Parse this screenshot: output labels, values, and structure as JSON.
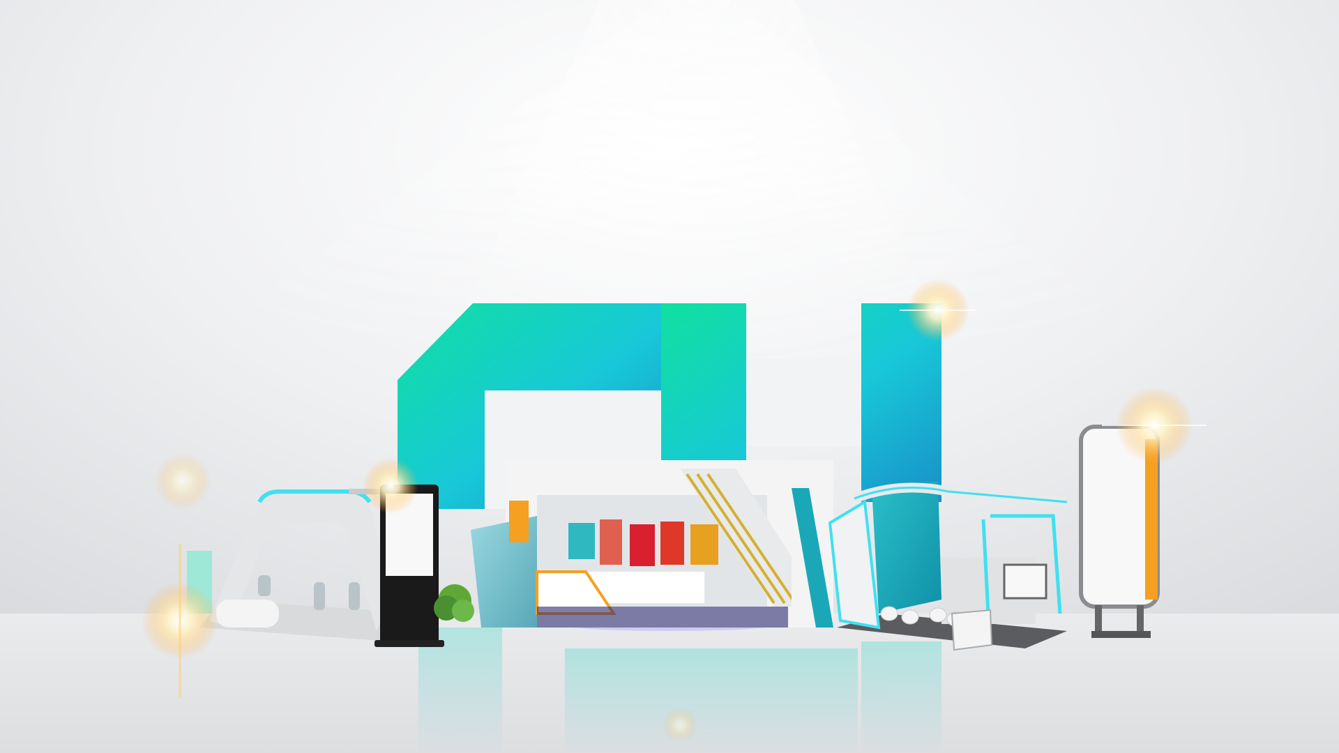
{
  "scene": {
    "subject": "exhibition-stands-render",
    "logo_letters": "CH",
    "colors": {
      "background": "#e8e9eb",
      "logo_green": "#10e0a0",
      "logo_cyan": "#18c8d8",
      "logo_blue": "#1898c8",
      "accent_cyan": "#40e0f0",
      "accent_orange": "#f5a020",
      "kiosk_black": "#1a1a1a",
      "booth_white": "#f4f4f4",
      "booth_teal": "#1aa8b8"
    },
    "icons": [
      "lens-flare-icon",
      "digital-kiosk-icon",
      "lightbox-stand-icon",
      "potted-shrub-icon"
    ]
  }
}
